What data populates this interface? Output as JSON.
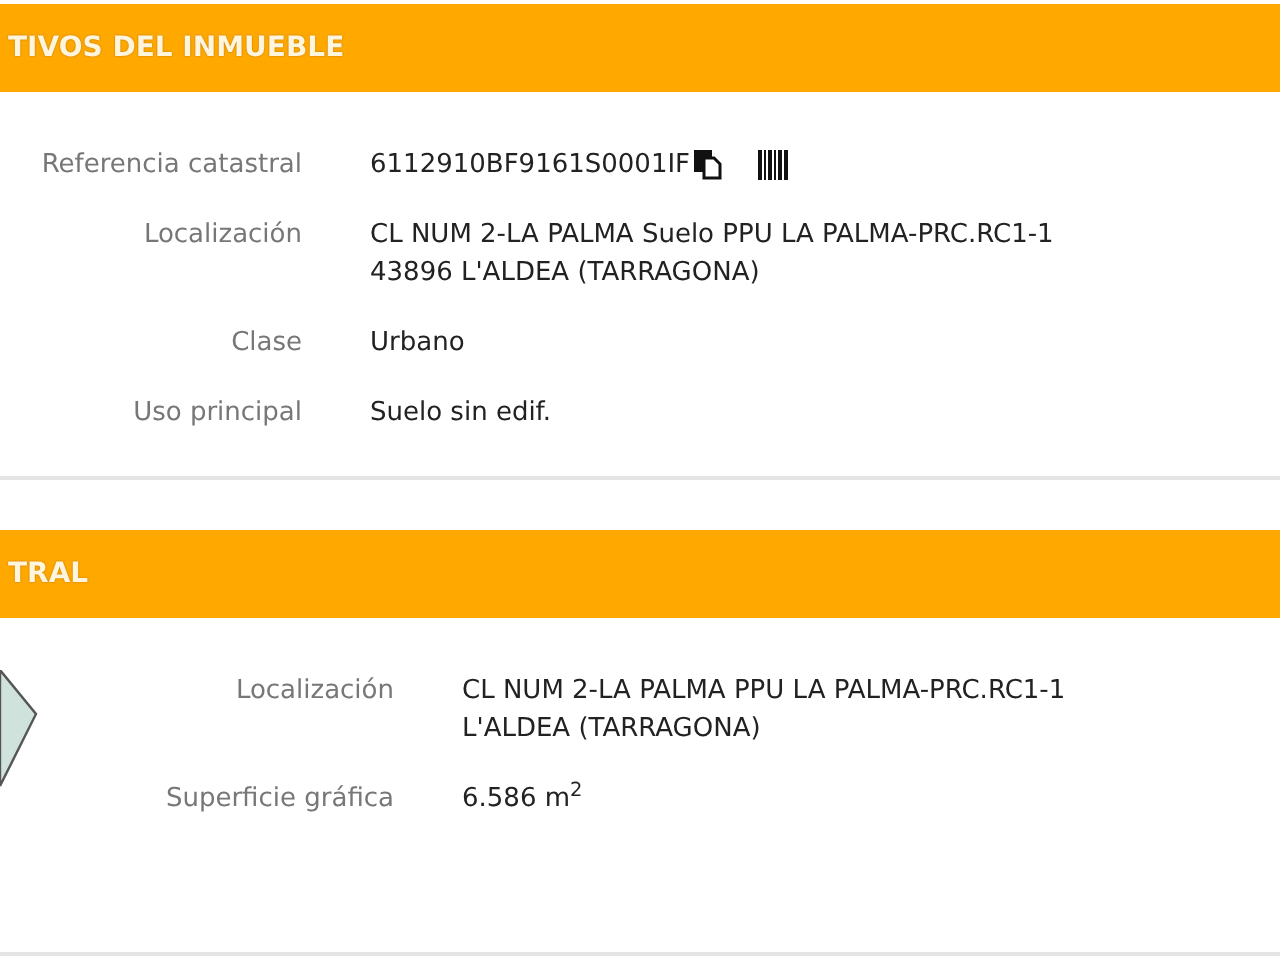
{
  "sections": [
    {
      "title": "TIVOS DEL INMUEBLE",
      "kind": "details",
      "rows": [
        {
          "label": "Referencia catastral",
          "lines": [
            "6112910BF9161S0001IF"
          ],
          "kind": "reference"
        },
        {
          "label": "Localización",
          "lines": [
            "CL NUM 2-LA PALMA Suelo PPU LA PALMA-PRC.RC1-1",
            "43896 L'ALDEA (TARRAGONA)"
          ],
          "kind": "text"
        },
        {
          "label": "Clase",
          "lines": [
            "Urbano"
          ],
          "kind": "text"
        },
        {
          "label": "Uso principal",
          "lines": [
            "Suelo sin edif."
          ],
          "kind": "text"
        }
      ]
    },
    {
      "title": "TRAL",
      "kind": "map",
      "rows": [
        {
          "label": "Localización",
          "lines": [
            "CL NUM 2-LA PALMA PPU LA PALMA-PRC.RC1-1",
            "L'ALDEA (TARRAGONA)"
          ],
          "kind": "text"
        },
        {
          "label": "Superficie gráfica",
          "lines": [
            "6.586 m$^{2}$"
          ],
          "kind": "text"
        }
      ]
    }
  ]
}
